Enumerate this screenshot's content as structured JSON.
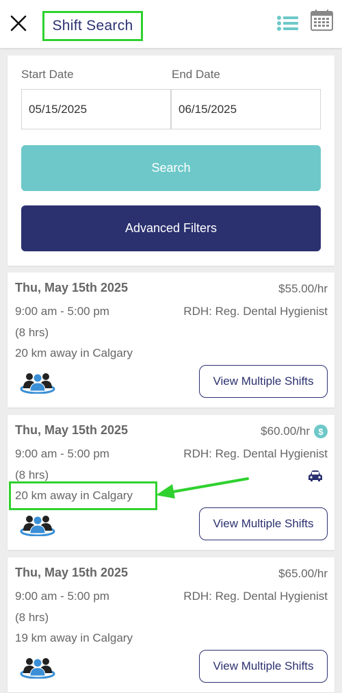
{
  "header": {
    "title": "Shift Search",
    "close_icon": "close-icon",
    "list_icon": "list-icon",
    "calendar_icon": "calendar-icon"
  },
  "search": {
    "start_label": "Start Date",
    "start_value": "05/15/2025",
    "end_label": "End Date",
    "end_value": "06/15/2025",
    "search_label": "Search",
    "advanced_label": "Advanced Filters"
  },
  "shifts": [
    {
      "date": "Thu, May 15th 2025",
      "rate": "$55.00/hr",
      "time": "9:00 am - 5:00 pm",
      "role": "RDH: Reg. Dental Hygienist",
      "duration": "(8 hrs)",
      "distance": "20 km away in Calgary",
      "button": "View Multiple Shifts"
    },
    {
      "date": "Thu, May 15th 2025",
      "rate": "$60.00/hr",
      "badge": "$",
      "time": "9:00 am - 5:00 pm",
      "role": "RDH: Reg. Dental Hygienist",
      "duration": "(8 hrs)",
      "distance": "20 km away in Calgary",
      "button": "View Multiple Shifts"
    },
    {
      "date": "Thu, May 15th 2025",
      "rate": "$65.00/hr",
      "time": "9:00 am - 5:00 pm",
      "role": "RDH: Reg. Dental Hygienist",
      "duration": "(8 hrs)",
      "distance": "19 km away in Calgary",
      "button": "View Multiple Shifts"
    }
  ],
  "colors": {
    "brand_navy": "#2b316f",
    "brand_teal": "#6ec8c9",
    "highlight_green": "#2fd12f",
    "background": "#ededed"
  }
}
